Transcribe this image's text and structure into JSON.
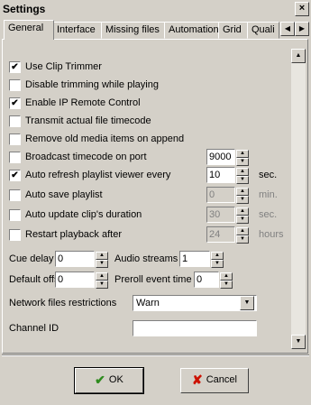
{
  "window": {
    "title": "Settings",
    "close_glyph": "×"
  },
  "tabs": [
    {
      "label": "General",
      "active": true
    },
    {
      "label": "Interface",
      "active": false
    },
    {
      "label": "Missing files",
      "active": false
    },
    {
      "label": "Automation",
      "active": false
    },
    {
      "label": "Grid",
      "active": false
    },
    {
      "label": "Quali",
      "active": false
    }
  ],
  "options": [
    {
      "label": "Use Clip Trimmer",
      "checked": true
    },
    {
      "label": "Disable trimming while playing",
      "checked": false
    },
    {
      "label": "Enable IP Remote Control",
      "checked": true
    },
    {
      "label": "Transmit actual file timecode",
      "checked": false
    },
    {
      "label": "Remove old media items on append",
      "checked": false
    },
    {
      "label": "Broadcast timecode on port",
      "checked": false,
      "value": "9000",
      "unit": "",
      "disabled": false
    },
    {
      "label": "Auto refresh playlist viewer every",
      "checked": true,
      "value": "10",
      "unit": "sec.",
      "disabled": false
    },
    {
      "label": "Auto save playlist",
      "checked": false,
      "value": "0",
      "unit": "min.",
      "disabled": true
    },
    {
      "label": "Auto update clip's duration",
      "checked": false,
      "value": "30",
      "unit": "sec.",
      "disabled": true
    },
    {
      "label": "Restart playback after",
      "checked": false,
      "value": "24",
      "unit": "hours",
      "disabled": true
    }
  ],
  "fields": {
    "cue_delay": {
      "label": "Cue delay",
      "value": "0"
    },
    "audio_streams": {
      "label": "Audio streams",
      "value": "1"
    },
    "default_offset": {
      "label": "Default offset",
      "value": "0"
    },
    "preroll_event_time": {
      "label": "Preroll event time",
      "value": "0"
    }
  },
  "network": {
    "label": "Network files restrictions",
    "value": "Warn"
  },
  "channel": {
    "label": "Channel ID",
    "value": ""
  },
  "buttons": {
    "ok": "OK",
    "cancel": "Cancel"
  },
  "icons": {
    "ok_icon": "check-icon",
    "cancel_icon": "x-icon",
    "check_mark": "✔",
    "x_mark": "✘"
  },
  "colors": {
    "face": "#d4d0c8",
    "ok_icon": "#2e8b1e",
    "cancel_icon": "#cc1100",
    "disabled_text": "#808080"
  }
}
